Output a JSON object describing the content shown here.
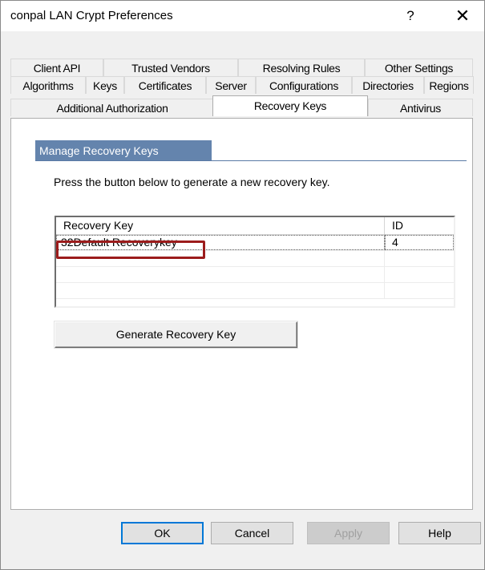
{
  "window": {
    "title": "conpal LAN Crypt Preferences",
    "help_glyph": "?",
    "close_glyph": "✕"
  },
  "tabs": {
    "row1": [
      "Client API",
      "Trusted Vendors",
      "Resolving Rules",
      "Other Settings"
    ],
    "row2": [
      "Algorithms",
      "Keys",
      "Certificates",
      "Server",
      "Configurations",
      "Directories",
      "Regions"
    ],
    "row3": [
      "Additional Authorization",
      "Recovery Keys",
      "Antivirus"
    ],
    "active": "Recovery Keys"
  },
  "panel": {
    "group_title": "Manage Recovery Keys",
    "instruction": "Press the button below to generate a new recovery key.",
    "list": {
      "columns": [
        "Recovery Key",
        "ID"
      ],
      "rows": [
        {
          "key": "32Default Recoverykey",
          "id": "4"
        }
      ]
    },
    "generate_button": "Generate Recovery Key"
  },
  "buttons": {
    "ok": "OK",
    "cancel": "Cancel",
    "apply": "Apply",
    "help": "Help"
  },
  "colors": {
    "group_header": "#6484ad",
    "highlight": "#9c1c1c",
    "default_button_border": "#0078d7"
  }
}
